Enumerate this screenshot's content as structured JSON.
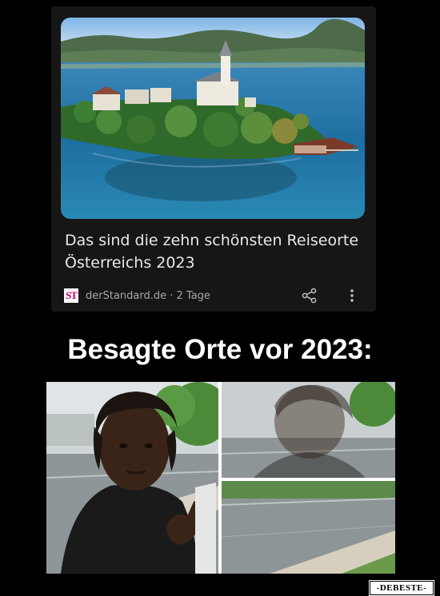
{
  "article": {
    "headline": "Das sind die zehn schönsten Reiseorte Österreichs 2023",
    "source_logo": "ST",
    "source": "derStandard.de · 2 Tage",
    "share_icon": "share-icon",
    "more_icon": "more-vert-icon"
  },
  "meme": {
    "caption": "Besagte Orte vor 2023:"
  },
  "watermark": "-DEBESTE-",
  "colors": {
    "background": "#000000",
    "card": "#161616",
    "headline": "#e8e8e8",
    "secondary_text": "#a8a8a8",
    "brand_magenta": "#c3006b",
    "lake": "#1e6fa0"
  }
}
